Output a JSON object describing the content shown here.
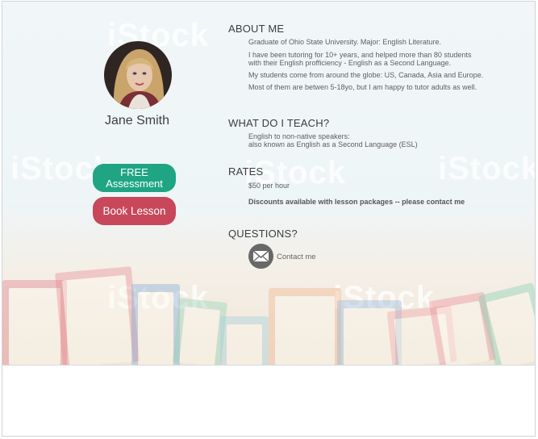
{
  "profile": {
    "name": "Jane Smith",
    "free_label_line1": "FREE",
    "free_label_line2": "Assessment",
    "book_label": "Book Lesson"
  },
  "about": {
    "heading": "ABOUT ME",
    "lines": [
      "Graduate of Ohio State University. Major: English Literature.",
      "I have been tutoring for 10+ years, and helped more than 80 students",
      "with their English profficiency - English as a Second Language.",
      "My students come from around the globe: US, Canada, Asia and Europe.",
      "Most of them are betwen 5-18yo, but I am happy to tutor adults as well."
    ]
  },
  "teach": {
    "heading": "WHAT DO I TEACH?",
    "line1": "English to non-native speakers:",
    "line2": "also known as English as a Second Language (ESL)"
  },
  "rates": {
    "heading": "RATES",
    "price": "$50 per hour",
    "discount": "Discounts available with lesson packages -- please contact me"
  },
  "questions": {
    "heading": "QUESTIONS?",
    "contact": "Contact me"
  },
  "watermark": "iStock",
  "icons": {
    "mail": "envelope-icon"
  },
  "colors": {
    "free_button": "#1fa584",
    "book_button": "#c8475a"
  }
}
